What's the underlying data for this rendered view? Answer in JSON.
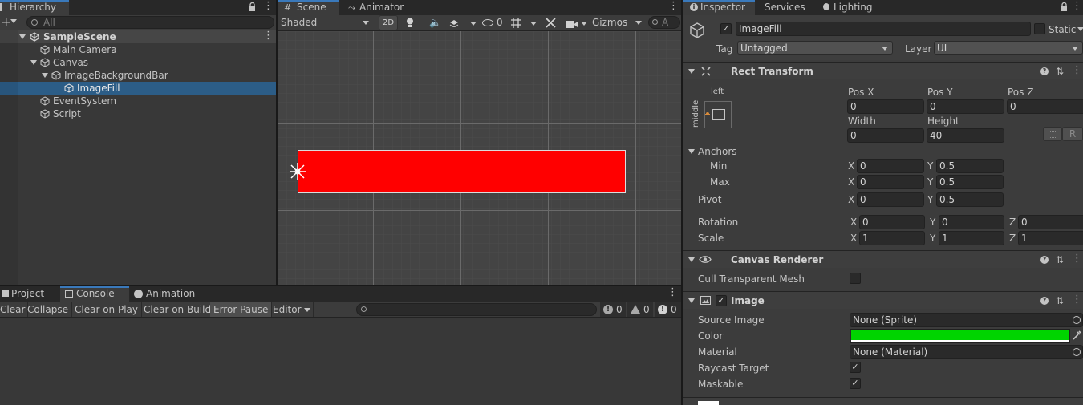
{
  "hierarchy": {
    "tab": "Hierarchy",
    "search_placeholder": "All",
    "items": [
      {
        "label": "SampleScene"
      },
      {
        "label": "Main Camera"
      },
      {
        "label": "Canvas"
      },
      {
        "label": "ImageBackgroundBar"
      },
      {
        "label": "ImageFill"
      },
      {
        "label": "EventSystem"
      },
      {
        "label": "Script"
      }
    ]
  },
  "scene": {
    "tabs": {
      "scene": "Scene",
      "animator": "Animator"
    },
    "shading": "Shaded",
    "mode_2d": "2D",
    "hidden_count": "0",
    "gizmos": "Gizmos",
    "search_placeholder": "A",
    "fill_color": "#ff0000"
  },
  "console": {
    "tabs": {
      "project": "Project",
      "console": "Console",
      "animation": "Animation"
    },
    "buttons": {
      "clear": "Clear",
      "collapse": "Collapse",
      "clear_on_play": "Clear on Play",
      "clear_on_build": "Clear on Build",
      "error_pause": "Error Pause",
      "editor": "Editor"
    },
    "counts": {
      "info": "0",
      "warn": "0",
      "error": "0"
    }
  },
  "inspector": {
    "tabs": {
      "inspector": "Inspector",
      "services": "Services",
      "lighting": "Lighting"
    },
    "object_name": "ImageFill",
    "static_label": "Static",
    "tag_label": "Tag",
    "tag_value": "Untagged",
    "layer_label": "Layer",
    "layer_value": "UI",
    "rect_transform": {
      "title": "Rect Transform",
      "anchor_h": "left",
      "anchor_v": "middle",
      "pos_x_label": "Pos X",
      "pos_x": "0",
      "pos_y_label": "Pos Y",
      "pos_y": "0",
      "pos_z_label": "Pos Z",
      "pos_z": "0",
      "width_label": "Width",
      "width": "0",
      "height_label": "Height",
      "height": "40",
      "r_button": "R",
      "anchors_label": "Anchors",
      "min_label": "Min",
      "min_x": "0",
      "min_y": "0.5",
      "max_label": "Max",
      "max_x": "0",
      "max_y": "0.5",
      "pivot_label": "Pivot",
      "pivot_x": "0",
      "pivot_y": "0.5",
      "rotation_label": "Rotation",
      "rot_x": "0",
      "rot_y": "0",
      "rot_z": "0",
      "scale_label": "Scale",
      "scale_x": "1",
      "scale_y": "1",
      "scale_z": "1",
      "axis_x": "X",
      "axis_y": "Y",
      "axis_z": "Z"
    },
    "canvas_renderer": {
      "title": "Canvas Renderer",
      "cull_label": "Cull Transparent Mesh"
    },
    "image": {
      "title": "Image",
      "source_label": "Source Image",
      "source_value": "None (Sprite)",
      "color_label": "Color",
      "color_value": "#00d400",
      "material_label": "Material",
      "material_value": "None (Material)",
      "raycast_label": "Raycast Target",
      "maskable_label": "Maskable"
    }
  }
}
